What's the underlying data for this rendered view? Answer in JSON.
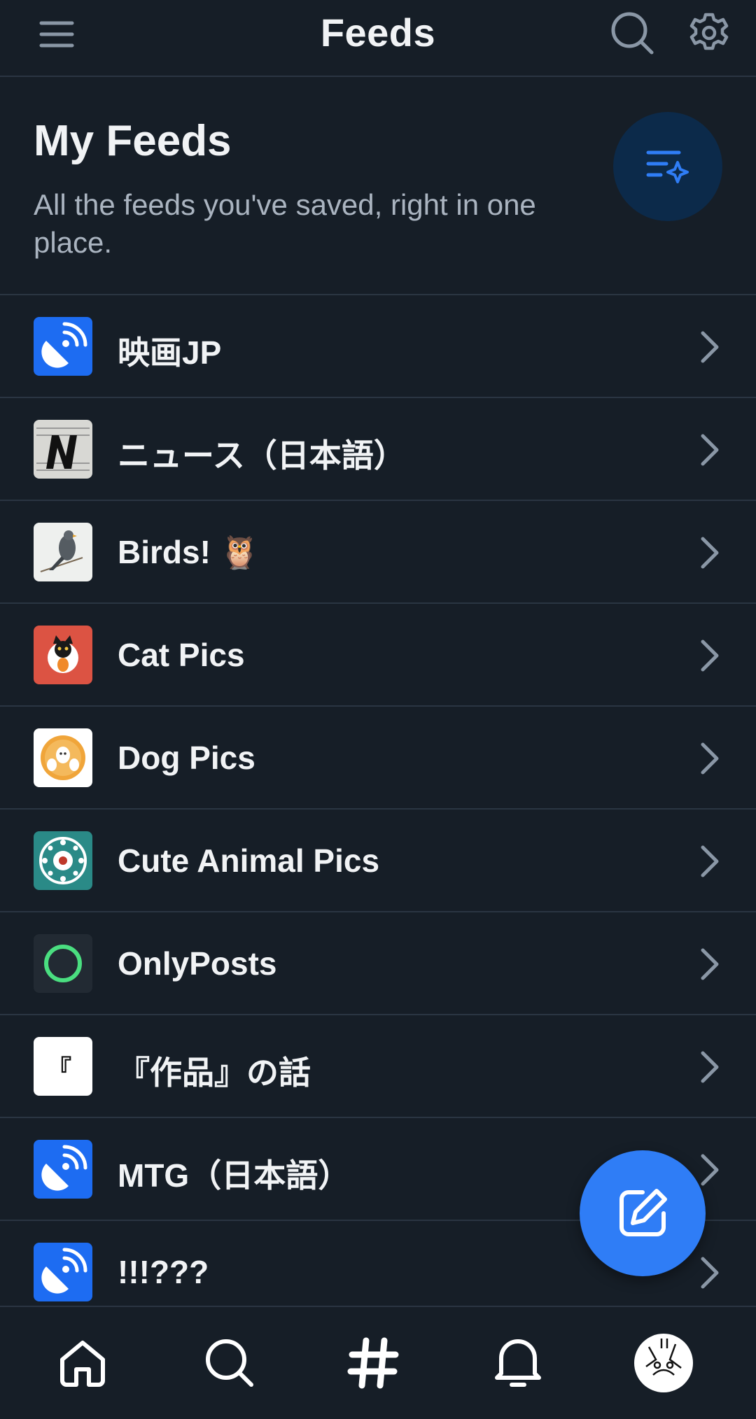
{
  "topbar": {
    "title": "Feeds"
  },
  "header": {
    "title": "My Feeds",
    "subtitle": "All the feeds you've saved, right in one place."
  },
  "feeds": [
    {
      "label": "映画JP",
      "icon": "satellite-dish-icon"
    },
    {
      "label": "ニュース（日本語）",
      "icon": "newspaper-n-icon"
    },
    {
      "label": "Birds! 🦉",
      "icon": "bird-photo-icon"
    },
    {
      "label": "Cat Pics",
      "icon": "cat-icon"
    },
    {
      "label": "Dog Pics",
      "icon": "dog-icon"
    },
    {
      "label": "Cute Animal Pics",
      "icon": "animal-wheel-icon"
    },
    {
      "label": "OnlyPosts",
      "icon": "ring-icon"
    },
    {
      "label": "『作品』の話",
      "icon": "bracket-icon",
      "icon_text": "『"
    },
    {
      "label": "MTG（日本語）",
      "icon": "satellite-dish-icon"
    },
    {
      "label": "!!!???",
      "icon": "satellite-dish-icon"
    }
  ],
  "colors": {
    "background": "#161e27",
    "divider": "#2a3542",
    "accent": "#2f7df6",
    "discover_bg": "#0c2a4a",
    "feed_blue": "#1d6cf2",
    "cat_red": "#dc5343",
    "teal": "#2a8a87",
    "ring_green": "#4ade80"
  },
  "nav": [
    "home-icon",
    "search-icon",
    "hashtag-icon",
    "bell-icon",
    "profile-avatar"
  ]
}
